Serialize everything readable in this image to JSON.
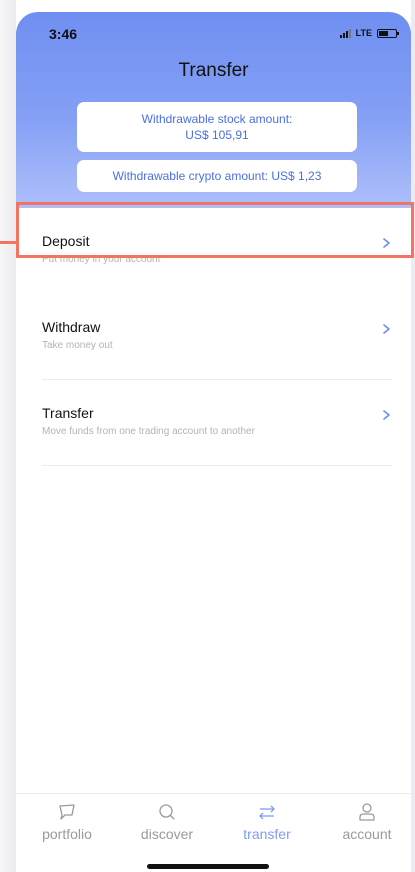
{
  "status_bar": {
    "time": "3:46",
    "network": "LTE"
  },
  "header": {
    "title": "Transfer",
    "stock_amount": {
      "label": "Withdrawable stock amount:",
      "value": "US$ 105,91"
    },
    "crypto_amount": {
      "text": "Withdrawable crypto amount: US$ 1,23"
    }
  },
  "options": [
    {
      "title": "Deposit",
      "subtitle": "Put money in your account"
    },
    {
      "title": "Withdraw",
      "subtitle": "Take money out"
    },
    {
      "title": "Transfer",
      "subtitle": "Move funds from one trading account to another"
    }
  ],
  "tabbar": {
    "tabs": [
      {
        "label": "portfolio",
        "icon": "portfolio-icon"
      },
      {
        "label": "discover",
        "icon": "search-icon"
      },
      {
        "label": "transfer",
        "icon": "transfer-arrows-icon"
      },
      {
        "label": "account",
        "icon": "person-icon"
      }
    ],
    "active": "transfer"
  },
  "colors": {
    "accent": "#7f9cf3",
    "link": "#4a6fe0",
    "highlight": "#f27561",
    "header_top": "#6f8ff1",
    "header_bottom": "#aebffa"
  }
}
